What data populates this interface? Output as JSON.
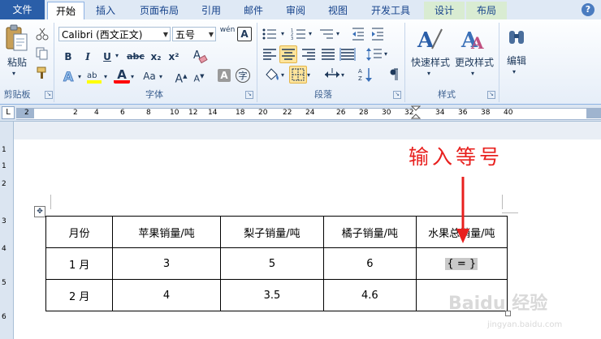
{
  "tabs": {
    "file": "文件",
    "items": [
      "开始",
      "插入",
      "页面布局",
      "引用",
      "邮件",
      "审阅",
      "视图",
      "开发工具",
      "设计",
      "布局"
    ],
    "active_index": 0,
    "help": "?"
  },
  "ribbon": {
    "clipboard": {
      "paste": "粘贴",
      "label": "剪贴板"
    },
    "font": {
      "name": "Calibri (西文正文)",
      "size": "五号",
      "phonetic": "wén",
      "border_char": "A",
      "bold": "B",
      "italic": "I",
      "underline": "U",
      "strike": "abc",
      "sub": "x₂",
      "sup": "x²",
      "color_a": "A",
      "case": "Aa",
      "grow": "A",
      "shrink": "A",
      "shade": "A",
      "enclose": "字",
      "label": "字体"
    },
    "paragraph": {
      "label": "段落"
    },
    "styles": {
      "quick": "快速样式",
      "change": "更改样式",
      "label": "样式"
    },
    "editing": {
      "label": "编辑"
    }
  },
  "ruler": {
    "tab_marker": "L",
    "numbers": [
      "2",
      "2",
      "4",
      "6",
      "8",
      "10",
      "12",
      "14",
      "18",
      "20",
      "22",
      "24",
      "26",
      "28",
      "30",
      "32",
      "34",
      "36",
      "38",
      "40"
    ],
    "vertical": [
      "1",
      "1",
      "2",
      "3",
      "4",
      "5",
      "6"
    ]
  },
  "table": {
    "headers": [
      "月份",
      "苹果销量/吨",
      "梨子销量/吨",
      "橘子销量/吨",
      "水果总销量/吨"
    ],
    "rows": [
      [
        "1 月",
        "3",
        "5",
        "6",
        "{ = }"
      ],
      [
        "2 月",
        "4",
        "3.5",
        "4.6",
        ""
      ]
    ]
  },
  "annotation": "输入等号",
  "watermark": {
    "main": "Baidu 经验",
    "sub": "jingyan.baidu.com"
  },
  "colors": {
    "accent": "#2a5ea8",
    "annotation": "#e8201e",
    "selected": "#fde49b"
  }
}
